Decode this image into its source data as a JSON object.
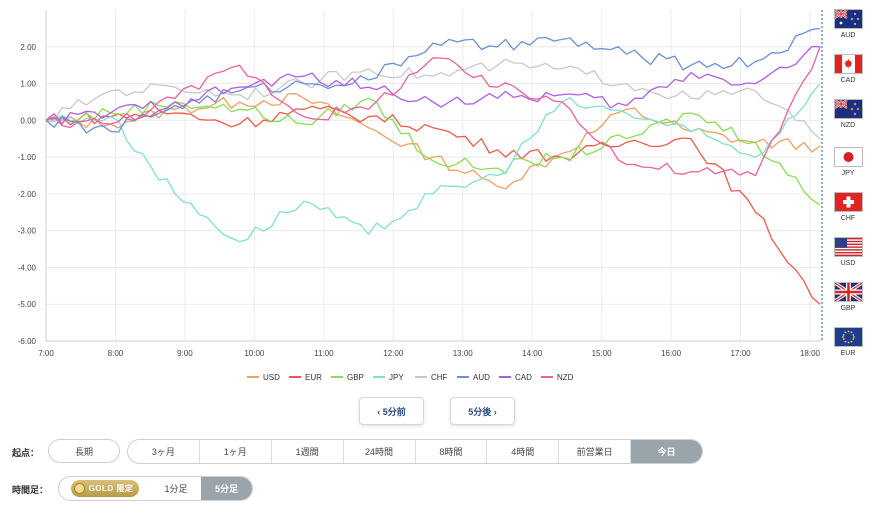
{
  "chart_data": {
    "type": "line",
    "x": [
      "7:00",
      "8:00",
      "9:00",
      "10:00",
      "11:00",
      "12:00",
      "13:00",
      "14:00",
      "15:00",
      "16:00",
      "17:00",
      "18:00"
    ],
    "ylim": [
      -6,
      3
    ],
    "yticks": [
      "2.00",
      "1.00",
      "0.00",
      "-1.00",
      "-2.00",
      "-3.00",
      "-4.00",
      "-5.00",
      "-6.00"
    ],
    "grid": true,
    "legend_position": "bottom",
    "series": [
      {
        "name": "USD",
        "color": "#f0a060",
        "values": [
          0,
          -0.1,
          0.3,
          0.5,
          0.6,
          -0.2,
          -1,
          -1.8,
          -0.9,
          0.3,
          -0.3,
          -0.6,
          -0.7
        ]
      },
      {
        "name": "EUR",
        "color": "#ee5a4a",
        "values": [
          0,
          0.1,
          0.2,
          -0.1,
          0.3,
          0.1,
          -0.2,
          -0.8,
          -1,
          -0.6,
          -0.5,
          -2.5,
          -5.0
        ]
      },
      {
        "name": "GBP",
        "color": "#88dd55",
        "values": [
          0,
          0.2,
          0.5,
          0.3,
          -0.1,
          0.6,
          -1.1,
          -1.3,
          -1.0,
          -0.5,
          0.2,
          -0.6,
          -2.3
        ]
      },
      {
        "name": "JPY",
        "color": "#80e0cf",
        "values": [
          0,
          0.1,
          -2,
          -3.3,
          -2.2,
          -3.1,
          -2.0,
          -1.5,
          0.5,
          0.2,
          -0.3,
          -1.0,
          1.0
        ]
      },
      {
        "name": "CHF",
        "color": "#c8c8c8",
        "values": [
          0,
          0.8,
          0.9,
          0.7,
          1.0,
          1.4,
          1.2,
          1.5,
          1.4,
          1.0,
          0.6,
          0.8,
          -0.5
        ]
      },
      {
        "name": "AUD",
        "color": "#6c8fd6",
        "values": [
          0,
          -0.3,
          0.4,
          0.8,
          1.0,
          1.1,
          2.1,
          2.0,
          2.2,
          1.8,
          1.5,
          1.6,
          2.5
        ]
      },
      {
        "name": "CAD",
        "color": "#b25de0",
        "values": [
          0,
          0.2,
          0.5,
          0.9,
          1.2,
          0.9,
          0.5,
          0.6,
          0.7,
          0.4,
          1.3,
          1.0,
          2.0
        ]
      },
      {
        "name": "NZD",
        "color": "#ee5fa0",
        "values": [
          0,
          -0.1,
          0.6,
          1.5,
          0.1,
          0.3,
          1.7,
          0.9,
          0.5,
          -1.2,
          -1.4,
          -1.5,
          2.0
        ]
      }
    ]
  },
  "flags": [
    {
      "code": "AUD",
      "icon": "australia-flag"
    },
    {
      "code": "CAD",
      "icon": "canada-flag"
    },
    {
      "code": "NZD",
      "icon": "new-zealand-flag"
    },
    {
      "code": "JPY",
      "icon": "japan-flag"
    },
    {
      "code": "CHF",
      "icon": "switzerland-flag"
    },
    {
      "code": "USD",
      "icon": "usa-flag"
    },
    {
      "code": "GBP",
      "icon": "uk-flag"
    },
    {
      "code": "EUR",
      "icon": "eu-flag"
    }
  ],
  "nav": {
    "prev": "‹ 5分前",
    "next": "5分後 ›"
  },
  "start": {
    "label": "起点：",
    "long": "長期",
    "options": [
      "3ヶ月",
      "1ヶ月",
      "1週間",
      "24時間",
      "8時間",
      "4時間",
      "前営業日",
      "今日"
    ],
    "selected": "今日"
  },
  "timeframe": {
    "label": "時間足：",
    "gold": "GOLD 限定",
    "one": "1分足",
    "five": "5分足",
    "selected": "5分足"
  }
}
